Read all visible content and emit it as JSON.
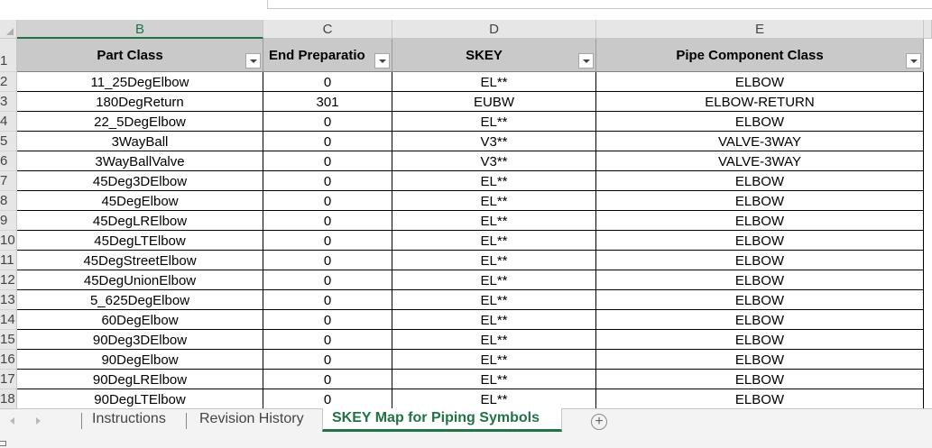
{
  "columns": {
    "b": "B",
    "c": "C",
    "d": "D",
    "e": "E"
  },
  "row_numbers": [
    "1",
    "2",
    "3",
    "4",
    "5",
    "6",
    "7",
    "8",
    "9",
    "10",
    "11",
    "12",
    "13",
    "14",
    "15",
    "16",
    "17",
    "18"
  ],
  "headers": {
    "part_class": "Part Class",
    "end_preparation": "End Preparatio",
    "skey": "SKEY",
    "pipe_component_class": "Pipe Component Class"
  },
  "rows": [
    {
      "part_class": "11_25DegElbow",
      "end_prep": "0",
      "skey": "EL**",
      "component": "ELBOW"
    },
    {
      "part_class": "180DegReturn",
      "end_prep": "301",
      "skey": "EUBW",
      "component": "ELBOW-RETURN"
    },
    {
      "part_class": "22_5DegElbow",
      "end_prep": "0",
      "skey": "EL**",
      "component": "ELBOW"
    },
    {
      "part_class": "3WayBall",
      "end_prep": "0",
      "skey": "V3**",
      "component": "VALVE-3WAY"
    },
    {
      "part_class": "3WayBallValve",
      "end_prep": "0",
      "skey": "V3**",
      "component": "VALVE-3WAY"
    },
    {
      "part_class": "45Deg3DElbow",
      "end_prep": "0",
      "skey": "EL**",
      "component": "ELBOW"
    },
    {
      "part_class": "45DegElbow",
      "end_prep": "0",
      "skey": "EL**",
      "component": "ELBOW"
    },
    {
      "part_class": "45DegLRElbow",
      "end_prep": "0",
      "skey": "EL**",
      "component": "ELBOW"
    },
    {
      "part_class": "45DegLTElbow",
      "end_prep": "0",
      "skey": "EL**",
      "component": "ELBOW"
    },
    {
      "part_class": "45DegStreetElbow",
      "end_prep": "0",
      "skey": "EL**",
      "component": "ELBOW"
    },
    {
      "part_class": "45DegUnionElbow",
      "end_prep": "0",
      "skey": "EL**",
      "component": "ELBOW"
    },
    {
      "part_class": "5_625DegElbow",
      "end_prep": "0",
      "skey": "EL**",
      "component": "ELBOW"
    },
    {
      "part_class": "60DegElbow",
      "end_prep": "0",
      "skey": "EL**",
      "component": "ELBOW"
    },
    {
      "part_class": "90Deg3DElbow",
      "end_prep": "0",
      "skey": "EL**",
      "component": "ELBOW"
    },
    {
      "part_class": "90DegElbow",
      "end_prep": "0",
      "skey": "EL**",
      "component": "ELBOW"
    },
    {
      "part_class": "90DegLRElbow",
      "end_prep": "0",
      "skey": "EL**",
      "component": "ELBOW"
    },
    {
      "part_class": "90DegLTElbow",
      "end_prep": "0",
      "skey": "EL**",
      "component": "ELBOW"
    }
  ],
  "tabs": {
    "instructions": "Instructions",
    "revision_history": "Revision History",
    "skey_map": "SKEY Map for Piping Symbols",
    "add_sheet": "+"
  },
  "colors": {
    "accent": "#217346",
    "header_fill": "#c9c9c9"
  }
}
